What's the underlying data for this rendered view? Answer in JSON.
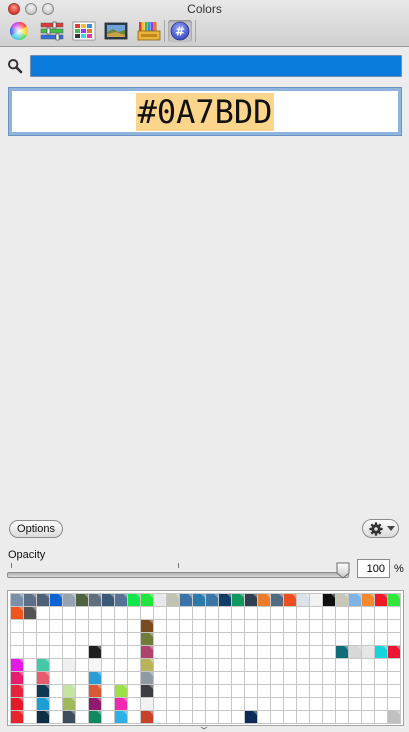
{
  "window": {
    "title": "Colors"
  },
  "toolbar": {
    "tabs": [
      {
        "id": "color-wheel",
        "icon": "color-wheel-icon"
      },
      {
        "id": "color-sliders",
        "icon": "sliders-icon"
      },
      {
        "id": "color-palettes",
        "icon": "palettes-icon"
      },
      {
        "id": "image-palettes",
        "icon": "image-icon"
      },
      {
        "id": "crayons",
        "icon": "crayons-icon"
      },
      {
        "id": "hex-color",
        "icon": "hash-icon",
        "label": "#",
        "selected": true
      }
    ]
  },
  "search": {
    "value": "",
    "highlight_color": "#0A7BDD"
  },
  "hex": {
    "value": "#0A7BDD",
    "highlight_color": "#FCD58D"
  },
  "options": {
    "label": "Options"
  },
  "opacity": {
    "label": "Opacity",
    "value": "100",
    "unit": "%",
    "level": 1.0
  },
  "swatches": {
    "columns": 30,
    "rows": 10,
    "filled": [
      [
        0,
        0,
        "#7b8fa8"
      ],
      [
        0,
        1,
        "#5b6f86"
      ],
      [
        0,
        2,
        "#4d6074"
      ],
      [
        0,
        3,
        "#0a64d6"
      ],
      [
        0,
        4,
        "#96a3b0"
      ],
      [
        0,
        5,
        "#4e6141"
      ],
      [
        0,
        6,
        "#5f6f7f"
      ],
      [
        0,
        7,
        "#3a5878"
      ],
      [
        0,
        8,
        "#547397"
      ],
      [
        0,
        9,
        "#11e64a"
      ],
      [
        0,
        10,
        "#1ee63a"
      ],
      [
        0,
        11,
        "#e8e8e8"
      ],
      [
        0,
        12,
        "#c2c2b0"
      ],
      [
        0,
        13,
        "#3d73a8"
      ],
      [
        0,
        14,
        "#2b7aa8"
      ],
      [
        0,
        15,
        "#3a76a6"
      ],
      [
        0,
        16,
        "#0f3f66"
      ],
      [
        0,
        17,
        "#119960"
      ],
      [
        0,
        18,
        "#2f3f4e"
      ],
      [
        0,
        19,
        "#ed7b2a"
      ],
      [
        0,
        20,
        "#526a82"
      ],
      [
        0,
        21,
        "#f14e20"
      ],
      [
        0,
        22,
        "#dbe2ea"
      ],
      [
        0,
        23,
        "#f2f2f2"
      ],
      [
        0,
        24,
        "#0f0f0f"
      ],
      [
        0,
        25,
        "#c7c7b8"
      ],
      [
        0,
        26,
        "#7cb4e6"
      ],
      [
        0,
        27,
        "#f7882c"
      ],
      [
        0,
        28,
        "#ee1b26"
      ],
      [
        0,
        29,
        "#2ee63c"
      ],
      [
        0,
        30,
        "#3a6fc6"
      ],
      [
        1,
        0,
        "#f1541c"
      ],
      [
        1,
        1,
        "#545454"
      ],
      [
        2,
        10,
        "#7a4a23"
      ],
      [
        3,
        10,
        "#6f7d3a"
      ],
      [
        4,
        6,
        "#1f1f1f"
      ],
      [
        4,
        10,
        "#b0436e"
      ],
      [
        4,
        25,
        "#0f6c79"
      ],
      [
        4,
        26,
        "#d8d8d8"
      ],
      [
        4,
        27,
        "#e6e6e6"
      ],
      [
        4,
        28,
        "#12d6da"
      ],
      [
        4,
        29,
        "#ee1433"
      ],
      [
        5,
        0,
        "#e619e6"
      ],
      [
        5,
        2,
        "#44c8a8"
      ],
      [
        5,
        4,
        "#f0f0f0"
      ],
      [
        5,
        6,
        "#f5f5f5"
      ],
      [
        5,
        10,
        "#b9b45a"
      ],
      [
        6,
        0,
        "#e61c6c"
      ],
      [
        6,
        2,
        "#e85d6e"
      ],
      [
        6,
        6,
        "#2a9dd6"
      ],
      [
        6,
        10,
        "#8f9aa5"
      ],
      [
        7,
        0,
        "#e9233c"
      ],
      [
        7,
        2,
        "#0f3952"
      ],
      [
        7,
        4,
        "#c5e3a2"
      ],
      [
        7,
        6,
        "#d85a34"
      ],
      [
        7,
        8,
        "#9ddf48"
      ],
      [
        7,
        10,
        "#3c3c44"
      ],
      [
        8,
        0,
        "#e6192b"
      ],
      [
        8,
        2,
        "#1e9ed6"
      ],
      [
        8,
        4,
        "#9fb85a"
      ],
      [
        8,
        6,
        "#8f1a6f"
      ],
      [
        8,
        8,
        "#f02ab0"
      ],
      [
        8,
        10,
        "#f2f2f2"
      ],
      [
        9,
        0,
        "#e9232b"
      ],
      [
        9,
        2,
        "#0f2f44"
      ],
      [
        9,
        4,
        "#3f4d5b"
      ],
      [
        9,
        6,
        "#0f8a62"
      ],
      [
        9,
        8,
        "#2eb0e6"
      ],
      [
        9,
        10,
        "#c8422a"
      ],
      [
        9,
        18,
        "#0f2a5a"
      ],
      [
        9,
        29,
        "#c0c0c0"
      ]
    ]
  }
}
